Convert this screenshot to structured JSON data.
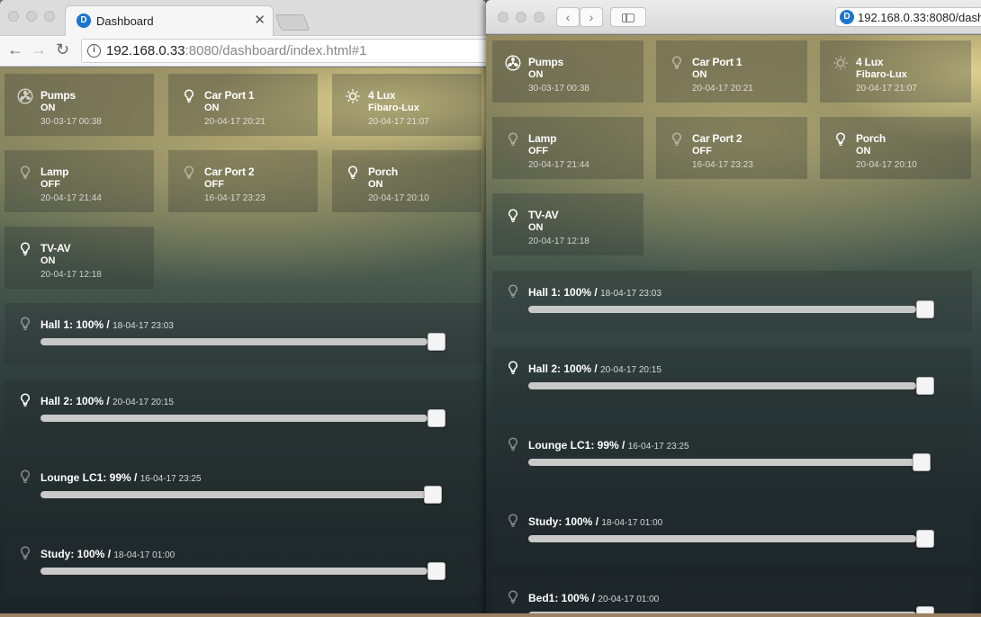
{
  "windowA": {
    "tab_title": "Dashboard",
    "url_host": "192.168.0.33",
    "url_rest": ":8080/dashboard/index.html#1"
  },
  "windowB": {
    "url_text": "192.168.0.33:8080/dash"
  },
  "tiles": [
    {
      "name": "Pumps",
      "state": "ON",
      "time": "30-03-17 00:38",
      "icon": "fan-icon"
    },
    {
      "name": "Car Port 1",
      "state": "ON",
      "time": "20-04-17 20:21",
      "icon": "bulb-icon"
    },
    {
      "name": "4 Lux",
      "state": "Fibaro-Lux",
      "time": "20-04-17 21:07",
      "icon": "sun-icon"
    },
    {
      "name": "Lamp",
      "state": "OFF",
      "time": "20-04-17 21:44",
      "icon": "bulb-icon"
    },
    {
      "name": "Car Port 2",
      "state": "OFF",
      "time": "16-04-17 23:23",
      "icon": "bulb-icon"
    },
    {
      "name": "Porch",
      "state": "ON",
      "time": "20-04-17 20:10",
      "icon": "bulb-icon"
    },
    {
      "name": "TV-AV",
      "state": "ON",
      "time": "20-04-17 12:18",
      "icon": "bulb-icon"
    }
  ],
  "dimmers": [
    {
      "label": "Hall 1: 100%",
      "time": "18-04-17 23:03",
      "level": 1.0,
      "icon": "bulb-icon"
    },
    {
      "label": "Hall 2: 100%",
      "time": "20-04-17 20:15",
      "level": 1.0,
      "icon": "bulb-icon"
    },
    {
      "label": "Lounge LC1: 99%",
      "time": "16-04-17 23:25",
      "level": 0.99,
      "icon": "bulb-icon"
    },
    {
      "label": "Study: 100%",
      "time": "18-04-17 01:00",
      "level": 1.0,
      "icon": "bulb-icon"
    },
    {
      "label": "Bed1: 100%",
      "time": "20-04-17 01:00",
      "level": 1.0,
      "icon": "bulb-icon"
    }
  ],
  "slash": " / "
}
